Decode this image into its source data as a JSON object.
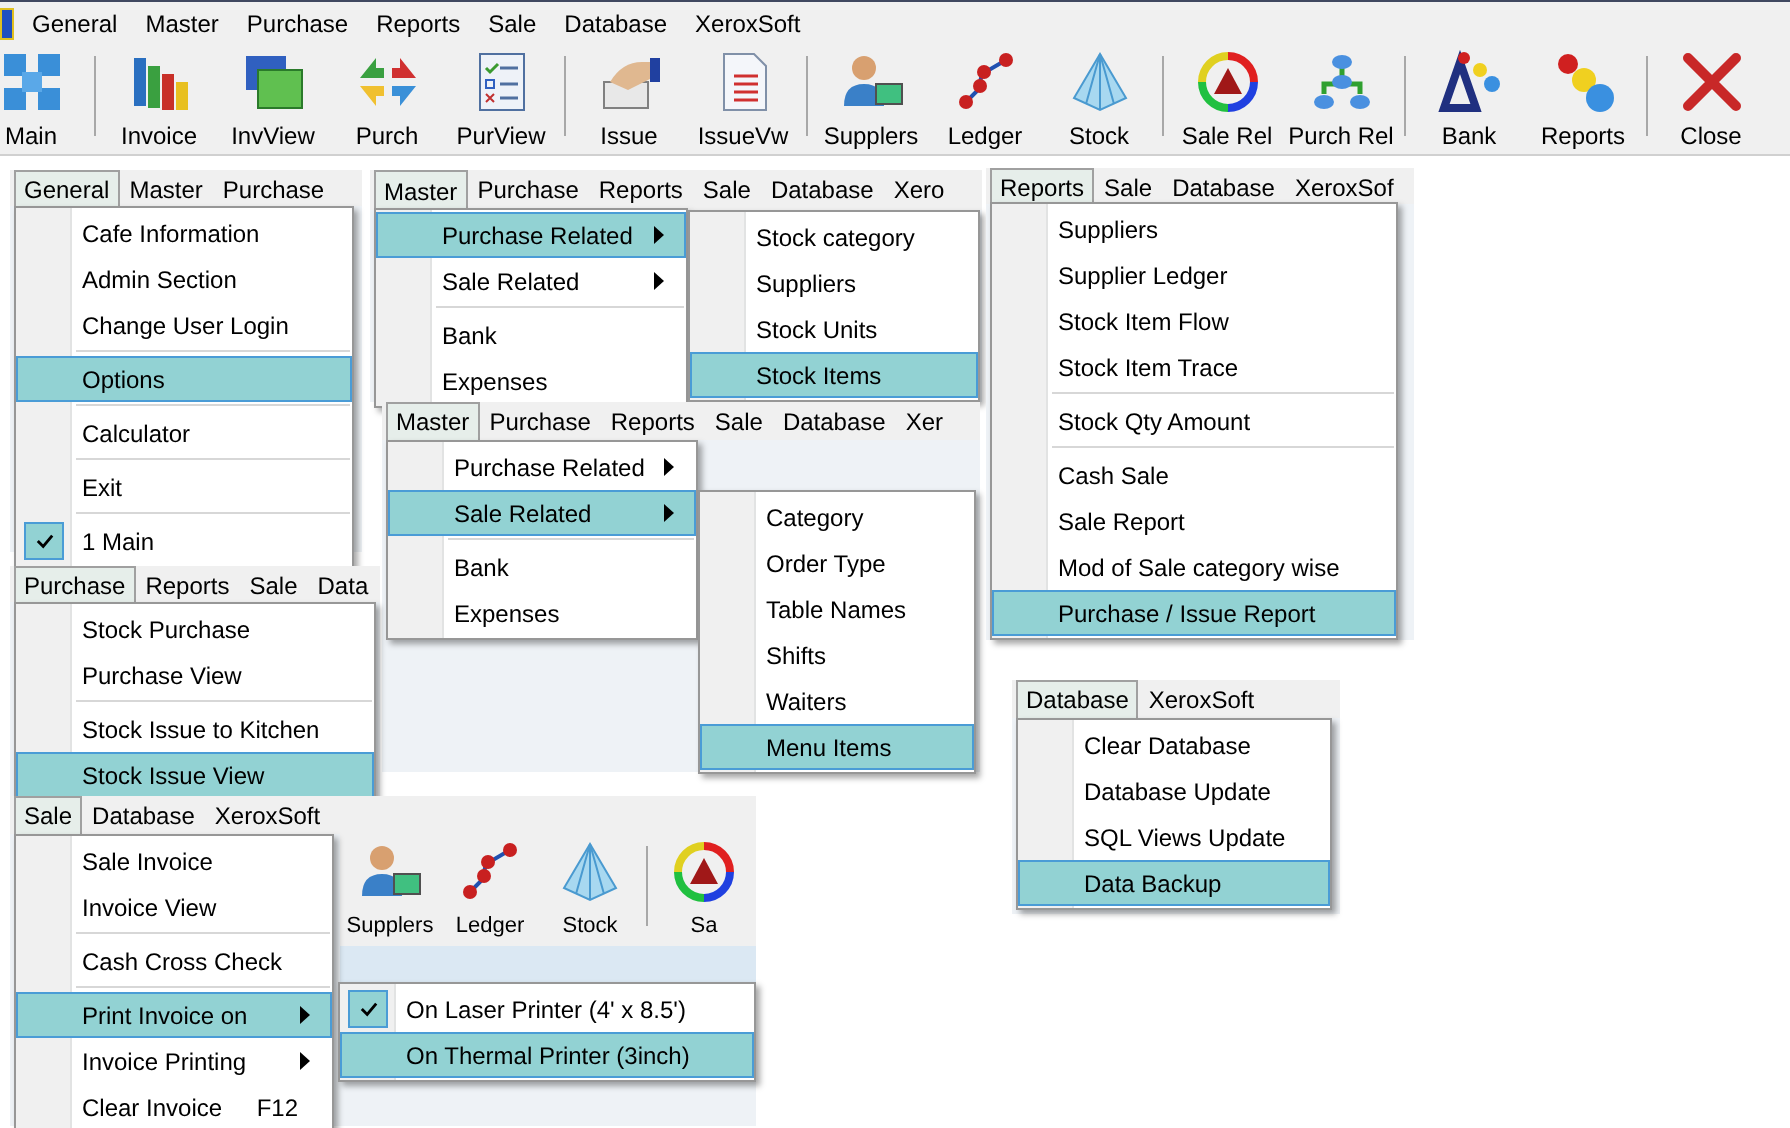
{
  "menubar": {
    "items": [
      {
        "label": "General",
        "selected": false
      },
      {
        "label": "Master",
        "selected": false
      },
      {
        "label": "Purchase",
        "selected": false
      },
      {
        "label": "Reports",
        "selected": false
      },
      {
        "label": "Sale",
        "selected": false
      },
      {
        "label": "Database",
        "selected": false
      },
      {
        "label": "XeroxSoft",
        "selected": false
      }
    ]
  },
  "toolbar": {
    "groups": [
      [
        {
          "label": "Main",
          "kind": "grid"
        }
      ],
      [
        {
          "label": "Invoice",
          "kind": "bars"
        },
        {
          "label": "InvView",
          "kind": "window"
        },
        {
          "label": "Purch",
          "kind": "arrows"
        },
        {
          "label": "PurView",
          "kind": "checklist"
        }
      ],
      [
        {
          "label": "Issue",
          "kind": "hand"
        },
        {
          "label": "IssueVw",
          "kind": "document"
        }
      ],
      [
        {
          "label": "Supplers",
          "kind": "user"
        },
        {
          "label": "Ledger",
          "kind": "nodes"
        },
        {
          "label": "Stock",
          "kind": "pyramid"
        }
      ],
      [
        {
          "label": "Sale Rel",
          "kind": "wheel"
        },
        {
          "label": "Purch Rel",
          "kind": "hierarchy"
        }
      ],
      [
        {
          "label": "Bank",
          "kind": "triangle"
        },
        {
          "label": "Reports",
          "kind": "balls"
        }
      ],
      [
        {
          "label": "Close",
          "kind": "close"
        }
      ]
    ]
  },
  "snippets": [
    {
      "bar": [
        {
          "label": "General",
          "selected": true
        },
        {
          "label": "Master",
          "selected": false
        },
        {
          "label": "Purchase",
          "selected": false
        }
      ],
      "menus": [
        {
          "items": [
            {
              "label": "Cafe Information",
              "selected": false,
              "checked": false
            },
            {
              "label": "Admin Section",
              "selected": false,
              "checked": false
            },
            {
              "label": "Change User Login",
              "selected": false,
              "checked": false
            },
            {
              "label": "Options",
              "selected": true,
              "checked": false,
              "divider_before": true
            },
            {
              "label": "Calculator",
              "selected": false,
              "checked": false,
              "divider_before": true
            },
            {
              "label": "Exit",
              "selected": false,
              "checked": false,
              "divider_before": true
            },
            {
              "label": "1 Main",
              "selected": false,
              "checked": true,
              "divider_before": true
            }
          ]
        }
      ]
    },
    {
      "bar": [
        {
          "label": "Master",
          "selected": true
        },
        {
          "label": "Purchase",
          "selected": false
        },
        {
          "label": "Reports",
          "selected": false
        },
        {
          "label": "Sale",
          "selected": false
        },
        {
          "label": "Database",
          "selected": false
        },
        {
          "label": "Xero",
          "selected": false
        }
      ],
      "menus": [
        {
          "items": [
            {
              "label": "Purchase Related",
              "selected": true,
              "submenu": true
            },
            {
              "label": "Sale Related",
              "selected": false,
              "submenu": true
            },
            {
              "label": "Bank",
              "selected": false,
              "submenu": false,
              "divider_before": true
            },
            {
              "label": "Expenses",
              "selected": false,
              "submenu": false
            }
          ]
        },
        {
          "items": [
            {
              "label": "Stock category",
              "selected": false
            },
            {
              "label": "Suppliers",
              "selected": false
            },
            {
              "label": "Stock Units",
              "selected": false
            },
            {
              "label": "Stock Items",
              "selected": true
            }
          ]
        }
      ]
    },
    {
      "bar": [
        {
          "label": "Master",
          "selected": true
        },
        {
          "label": "Purchase",
          "selected": false
        },
        {
          "label": "Reports",
          "selected": false
        },
        {
          "label": "Sale",
          "selected": false
        },
        {
          "label": "Database",
          "selected": false
        },
        {
          "label": "Xer",
          "selected": false
        }
      ],
      "menus": [
        {
          "items": [
            {
              "label": "Purchase Related",
              "selected": false,
              "submenu": true
            },
            {
              "label": "Sale Related",
              "selected": true,
              "submenu": true
            },
            {
              "label": "Bank",
              "selected": false,
              "submenu": false,
              "divider_before": true
            },
            {
              "label": "Expenses",
              "selected": false,
              "submenu": false
            }
          ]
        },
        {
          "items": [
            {
              "label": "Category",
              "selected": false
            },
            {
              "label": "Order Type",
              "selected": false
            },
            {
              "label": "Table Names",
              "selected": false
            },
            {
              "label": "Shifts",
              "selected": false
            },
            {
              "label": "Waiters",
              "selected": false
            },
            {
              "label": "Menu Items",
              "selected": true
            }
          ]
        }
      ]
    },
    {
      "bar": [
        {
          "label": "Reports",
          "selected": true
        },
        {
          "label": "Sale",
          "selected": false
        },
        {
          "label": "Database",
          "selected": false
        },
        {
          "label": "XeroxSof",
          "selected": false
        }
      ],
      "menus": [
        {
          "items": [
            {
              "label": "Suppliers",
              "selected": false
            },
            {
              "label": "Supplier Ledger",
              "selected": false
            },
            {
              "label": "Stock Item Flow",
              "selected": false
            },
            {
              "label": "Stock Item Trace",
              "selected": false
            },
            {
              "label": "Stock Qty Amount",
              "selected": false,
              "divider_before": true
            },
            {
              "label": "Cash Sale",
              "selected": false,
              "divider_before": true
            },
            {
              "label": "Sale Report",
              "selected": false
            },
            {
              "label": "Mod of Sale category wise",
              "selected": false
            },
            {
              "label": "Purchase / Issue Report",
              "selected": true
            }
          ]
        }
      ]
    },
    {
      "bar": [
        {
          "label": "Purchase",
          "selected": true
        },
        {
          "label": "Reports",
          "selected": false
        },
        {
          "label": "Sale",
          "selected": false
        },
        {
          "label": "Data",
          "selected": false
        }
      ],
      "menus": [
        {
          "items": [
            {
              "label": "Stock Purchase",
              "selected": false
            },
            {
              "label": "Purchase View",
              "selected": false
            },
            {
              "label": "Stock Issue to Kitchen",
              "selected": false,
              "divider_before": true
            },
            {
              "label": "Stock Issue View",
              "selected": true
            }
          ]
        }
      ]
    },
    {
      "bar": [
        {
          "label": "Sale",
          "selected": true
        },
        {
          "label": "Database",
          "selected": false
        },
        {
          "label": "XeroxSoft",
          "selected": false
        }
      ],
      "toolbar_fragment": {
        "groups": [
          [
            {
              "label": "Supplers",
              "kind": "user"
            },
            {
              "label": "Ledger",
              "kind": "nodes"
            },
            {
              "label": "Stock",
              "kind": "pyramid"
            }
          ],
          [
            {
              "label": "Sa",
              "kind": "wheel"
            }
          ]
        ]
      },
      "menus": [
        {
          "items": [
            {
              "label": "Sale Invoice",
              "selected": false,
              "submenu": false
            },
            {
              "label": "Invoice View",
              "selected": false,
              "submenu": false
            },
            {
              "label": "Cash Cross Check",
              "selected": false,
              "submenu": false,
              "divider_before": true
            },
            {
              "label": "Print Invoice on",
              "selected": true,
              "submenu": true,
              "divider_before": true
            },
            {
              "label": "Invoice Printing",
              "selected": false,
              "submenu": true
            },
            {
              "label": "Clear Invoice",
              "selected": false,
              "submenu": false,
              "shortcut": "F12"
            }
          ]
        },
        {
          "items": [
            {
              "label": "On Laser Printer (4' x 8.5')",
              "selected": false,
              "checked": true
            },
            {
              "label": "On Thermal Printer (3inch)",
              "selected": true,
              "checked": false
            }
          ]
        }
      ]
    },
    {
      "bar": [
        {
          "label": "Database",
          "selected": true
        },
        {
          "label": "XeroxSoft",
          "selected": false
        }
      ],
      "menus": [
        {
          "items": [
            {
              "label": "Clear Database",
              "selected": false
            },
            {
              "label": "Database Update",
              "selected": false
            },
            {
              "label": "SQL Views Update",
              "selected": false
            },
            {
              "label": "Data Backup",
              "selected": true
            }
          ]
        }
      ]
    }
  ]
}
